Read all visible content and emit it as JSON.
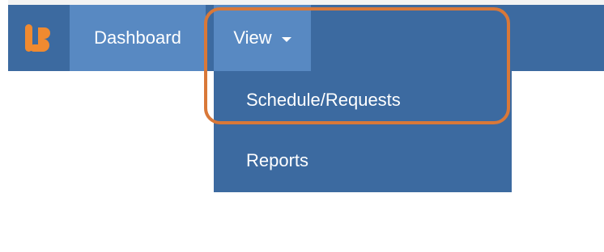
{
  "brand": {
    "logo_icon": "lb-logo-icon",
    "accent_color": "#f08a30"
  },
  "nav": {
    "dashboard_label": "Dashboard",
    "view_label": "View",
    "view_caret_icon": "caret-down-icon"
  },
  "dropdown": {
    "items": [
      {
        "label": "Schedule/Requests"
      },
      {
        "label": "Reports"
      }
    ]
  },
  "annotation": {
    "highlight_color": "#d97838"
  }
}
